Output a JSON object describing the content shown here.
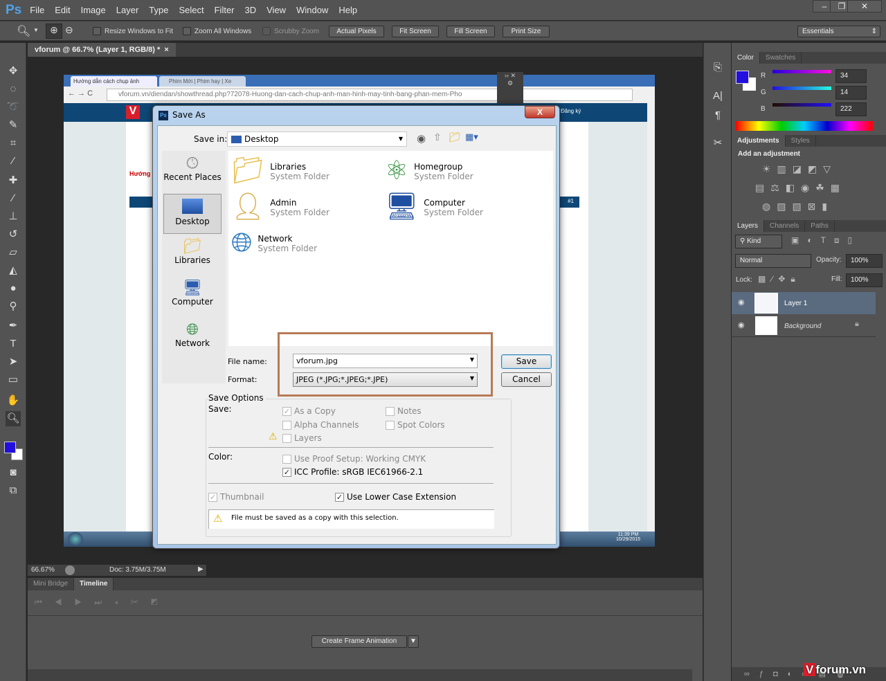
{
  "app": {
    "logo": "Ps",
    "menu": [
      "File",
      "Edit",
      "Image",
      "Layer",
      "Type",
      "Select",
      "Filter",
      "3D",
      "View",
      "Window",
      "Help"
    ],
    "window_controls": [
      "–",
      "❐",
      "✕"
    ]
  },
  "options": {
    "resize_windows": "Resize Windows to Fit",
    "zoom_all": "Zoom All Windows",
    "scrubby": "Scrubby Zoom",
    "actual_pixels": "Actual Pixels",
    "fit_screen": "Fit Screen",
    "fill_screen": "Fill Screen",
    "print_size": "Print Size",
    "workspace": "Essentials"
  },
  "document": {
    "tab_title": "vforum @ 66.7% (Layer 1, RGB/8) *",
    "close": "×"
  },
  "browser": {
    "tab1": "Hướng dẫn cách chụp ảnh",
    "tab2": "Phim Mới | Phim hay | Xe",
    "url": "vforum.vn/diendan/showthread.php?72078-Huong-dan-cach-chup-anh-man-hinh-may-tinh-bang-phan-mem-Pho",
    "register": "Đăng ký",
    "post_num": "#1",
    "clock_time": "11:39 PM",
    "clock_date": "10/29/2015",
    "heading_fragment": "Hướng"
  },
  "status": {
    "zoom": "66.67%",
    "doc": "Doc: 3.75M/3.75M"
  },
  "timeline": {
    "tabs": [
      "Mini Bridge",
      "Timeline"
    ],
    "create_button": "Create Frame Animation"
  },
  "color_panel": {
    "tabs": [
      "Color",
      "Swatches"
    ],
    "r_label": "R",
    "g_label": "G",
    "b_label": "B",
    "r": "34",
    "g": "14",
    "b": "222",
    "foreground": "#220ede",
    "background": "#ffffff"
  },
  "adjustments_panel": {
    "tabs": [
      "Adjustments",
      "Styles"
    ],
    "heading": "Add an adjustment"
  },
  "layers_panel": {
    "tabs": [
      "Layers",
      "Channels",
      "Paths"
    ],
    "kind": "Kind",
    "blend_mode": "Normal",
    "opacity_label": "Opacity:",
    "opacity": "100%",
    "lock_label": "Lock:",
    "fill_label": "Fill:",
    "fill": "100%",
    "layers": [
      {
        "name": "Layer 1",
        "selected": true
      },
      {
        "name": "Background",
        "locked": true
      }
    ]
  },
  "dialog": {
    "title": "Save As",
    "save_in_label": "Save in:",
    "save_in": "Desktop",
    "places": [
      "Recent Places",
      "Desktop",
      "Libraries",
      "Computer",
      "Network"
    ],
    "items": [
      {
        "name": "Libraries",
        "type": "System Folder"
      },
      {
        "name": "Homegroup",
        "type": "System Folder"
      },
      {
        "name": "Admin",
        "type": "System Folder"
      },
      {
        "name": "Computer",
        "type": "System Folder"
      },
      {
        "name": "Network",
        "type": "System Folder"
      }
    ],
    "file_name_label": "File name:",
    "file_name": "vforum.jpg",
    "format_label": "Format:",
    "format": "JPEG (*.JPG;*.JPEG;*.JPE)",
    "save_button": "Save",
    "cancel_button": "Cancel",
    "save_options": "Save Options",
    "save_label": "Save:",
    "as_copy": "As a Copy",
    "notes": "Notes",
    "alpha": "Alpha Channels",
    "spot": "Spot Colors",
    "layers": "Layers",
    "color_label": "Color:",
    "proof": "Use Proof Setup:  Working CMYK",
    "icc": "ICC Profile:  sRGB IEC61966-2.1",
    "thumbnail": "Thumbnail",
    "lower_case": "Use Lower Case Extension",
    "warning": "File must be saved as a copy with this selection.",
    "highlight_color": "#b87a56"
  },
  "watermark": "Vforum.vn"
}
